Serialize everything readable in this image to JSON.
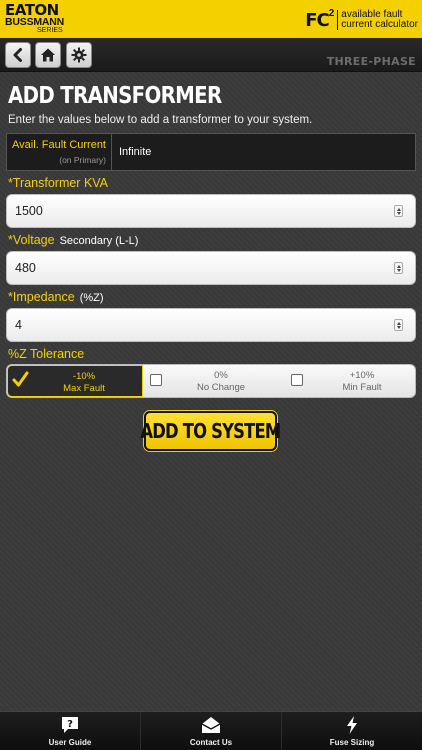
{
  "header": {
    "brand_line1": "EATON",
    "brand_line2": "BUSSMANN",
    "brand_line3": "SERIES",
    "app_logo": "FC",
    "app_logo_sup": "2",
    "app_subtitle_1": "available fault",
    "app_subtitle_2": "current calculator"
  },
  "nav": {
    "back_icon": "chevron-left-icon",
    "home_icon": "home-icon",
    "settings_icon": "gear-icon",
    "mode_label": "THREE-PHASE"
  },
  "page": {
    "title": "ADD TRANSFORMER",
    "intro": "Enter the values below to add a transformer to your system."
  },
  "afc": {
    "label": "Avail. Fault Current",
    "sublabel": "(on Primary)",
    "value": "Infinite"
  },
  "fields": {
    "kva": {
      "label": "*Transformer KVA",
      "hint": "",
      "value": "1500"
    },
    "voltage": {
      "label": "*Voltage",
      "hint": "Secondary (L-L)",
      "value": "480"
    },
    "impedance": {
      "label": "*Impedance",
      "hint": "(%Z)",
      "value": "4"
    }
  },
  "tolerance": {
    "label": "%Z Tolerance",
    "options": [
      {
        "line1": "-10%",
        "line2": "Max Fault",
        "selected": true
      },
      {
        "line1": "0%",
        "line2": "No Change",
        "selected": false
      },
      {
        "line1": "+10%",
        "line2": "Min Fault",
        "selected": false
      }
    ]
  },
  "actions": {
    "add_label": "ADD TO SYSTEM"
  },
  "tabbar": {
    "items": [
      {
        "label": "User Guide",
        "icon": "help-icon"
      },
      {
        "label": "Contact Us",
        "icon": "envelope-icon"
      },
      {
        "label": "Fuse Sizing",
        "icon": "lightning-icon"
      }
    ]
  },
  "colors": {
    "accent": "#f5d000",
    "background": "#3a3a3a",
    "bar": "#1a1a1a"
  }
}
